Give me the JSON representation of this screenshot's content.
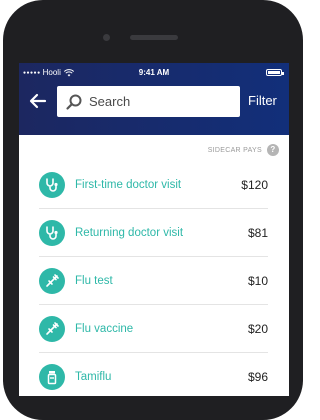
{
  "status_bar": {
    "carrier": "Hooli",
    "time": "9:41 AM"
  },
  "header": {
    "search_placeholder": "Search",
    "filter_label": "Filter"
  },
  "list_header": {
    "label": "SIDECAR PAYS",
    "help": "?"
  },
  "items": [
    {
      "name": "First-time doctor visit",
      "price": "$120",
      "icon": "stethoscope-icon"
    },
    {
      "name": "Returning doctor visit",
      "price": "$81",
      "icon": "stethoscope-icon"
    },
    {
      "name": "Flu test",
      "price": "$10",
      "icon": "syringe-icon"
    },
    {
      "name": "Flu vaccine",
      "price": "$20",
      "icon": "syringe-icon"
    },
    {
      "name": "Tamiflu",
      "price": "$96",
      "icon": "pill-bottle-icon"
    }
  ],
  "colors": {
    "accent": "#2eb8a8",
    "header_start": "#1c2760",
    "header_end": "#122f7a"
  }
}
